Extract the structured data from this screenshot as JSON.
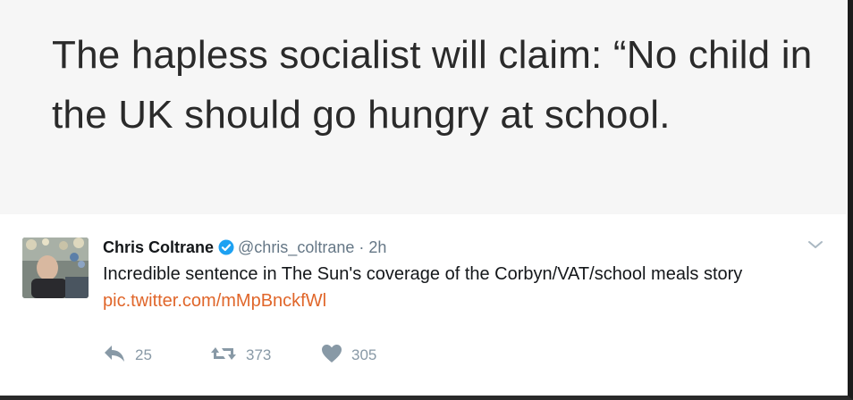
{
  "quote_image": {
    "text": "The hapless socialist will claim: “No child in the UK should go hungry at school."
  },
  "tweet": {
    "author_name": "Chris Coltrane",
    "verified": true,
    "handle": "@chris_coltrane",
    "separator": "·",
    "time": "2h",
    "text": "Incredible sentence in The Sun's coverage of the Corbyn/VAT/school meals story",
    "link": "pic.twitter.com/mMpBnckfWl",
    "colors": {
      "link": "#e0662a",
      "verified": "#1da1f2",
      "muted": "#657786"
    }
  },
  "actions": [
    {
      "name": "reply",
      "icon": "reply-icon",
      "count": "25"
    },
    {
      "name": "retweet",
      "icon": "retweet-icon",
      "count": "373"
    },
    {
      "name": "like",
      "icon": "heart-icon",
      "count": "305"
    }
  ]
}
